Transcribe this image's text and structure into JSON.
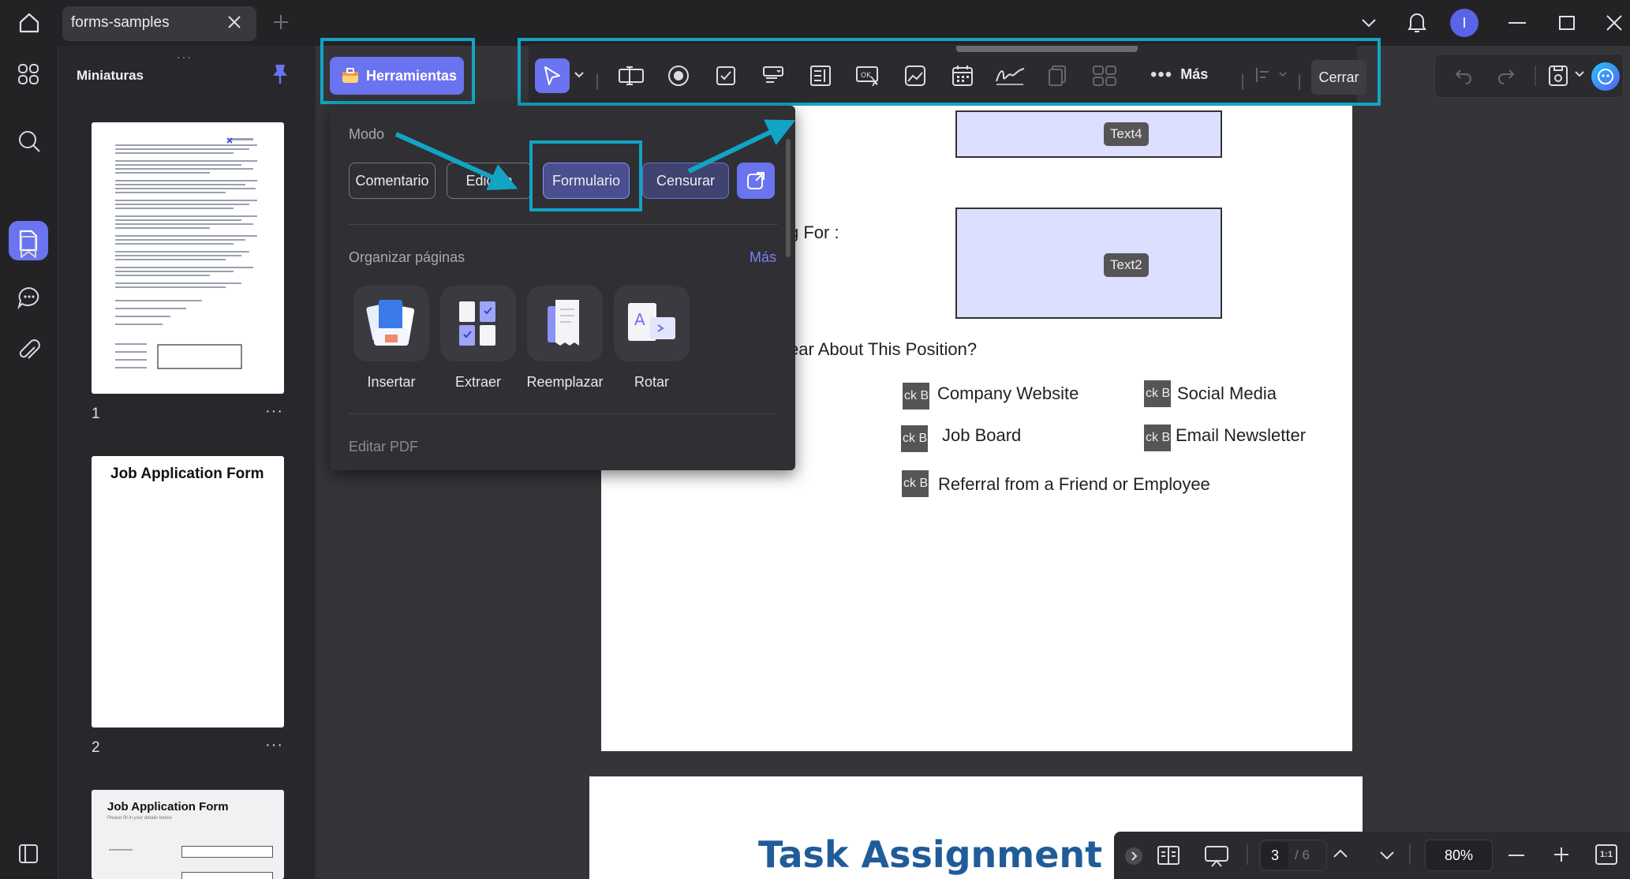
{
  "tab": {
    "title": "forms-samples"
  },
  "sidebar": {
    "title": "Miniaturas",
    "pages": [
      "1",
      "2"
    ],
    "more": "···"
  },
  "thumb2": {
    "title": "Job Application Form"
  },
  "thumb3": {
    "title": "Job Application Form",
    "subtitle": "Please fill in your details below"
  },
  "tools_button": {
    "label": "Herramientas"
  },
  "toolbar": {
    "more_label": "Más",
    "close_label": "Cerrar"
  },
  "popup": {
    "mode_label": "Modo",
    "modes": [
      "Comentario",
      "Edición",
      "Formulario",
      "Censurar"
    ],
    "organize_label": "Organizar páginas",
    "organize_more": "Más",
    "tiles": [
      "Insertar",
      "Extraer",
      "Reemplazar",
      "Rotar"
    ],
    "edit_label": "Editar PDF"
  },
  "page": {
    "field_a": "Text4",
    "field_b": "Text2",
    "fragment_for": "g For :",
    "question": "ear About This Position?",
    "checkbox_text": "ck B",
    "options": [
      "Company Website",
      "Social Media",
      "Job Board",
      "Email Newsletter",
      "Referral from a Friend or Employee"
    ]
  },
  "next_page": {
    "title": "Task Assignment Forr"
  },
  "bottom": {
    "page_current": "3",
    "page_total": "/ 6",
    "zoom": "80%",
    "fit": "1:1"
  },
  "colors": {
    "accent": "#6a73f0",
    "highlight": "#12a4c4",
    "title_blue": "#1f5c99"
  }
}
